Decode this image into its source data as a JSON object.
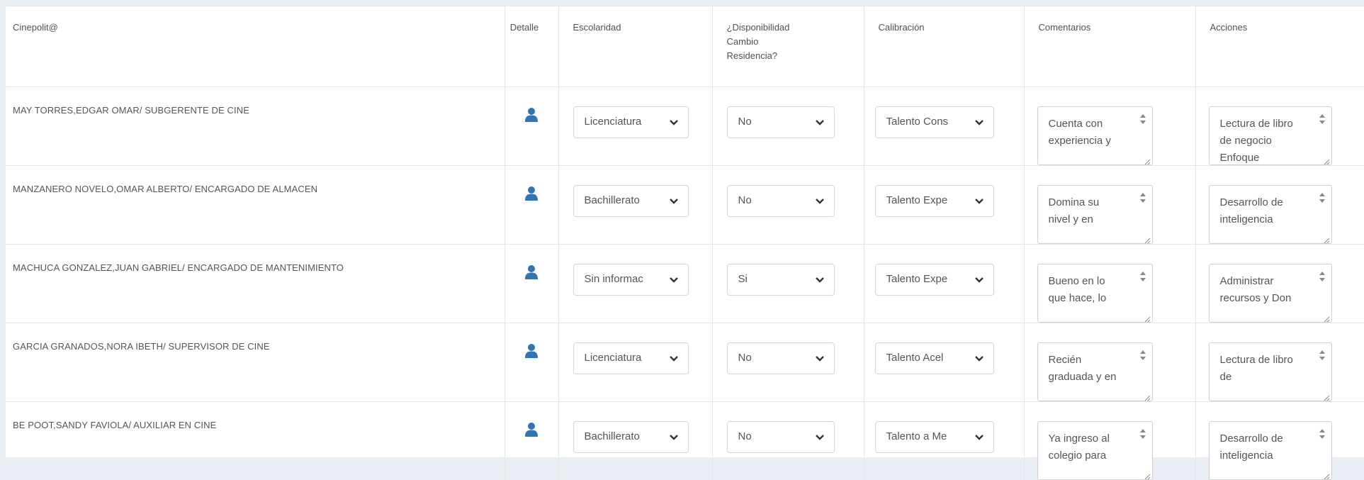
{
  "table": {
    "headers": {
      "cinepolita": "Cinepolit@",
      "detalle": "Detalle",
      "escolaridad": "Escolaridad",
      "disponibilidad_line1": "¿Disponibilidad",
      "disponibilidad_line2": "Cambio",
      "disponibilidad_line3": "Residencia?",
      "calibracion": "Calibración",
      "comentarios": "Comentarios",
      "acciones": "Acciones"
    },
    "rows": [
      {
        "name": "MAY TORRES,EDGAR OMAR/ SUBGERENTE DE CINE",
        "escolaridad": "Licenciatura",
        "disponibilidad": "No",
        "calibracion": "Talento Cons",
        "comentarios": "Cuenta con experiencia y",
        "acciones": "Lectura de libro de negocio Enfoque"
      },
      {
        "name": "MANZANERO NOVELO,OMAR ALBERTO/ ENCARGADO DE ALMACEN",
        "escolaridad": "Bachillerato",
        "disponibilidad": "No",
        "calibracion": "Talento Expe",
        "comentarios": "Domina su nivel y en",
        "acciones": "Desarrollo de inteligencia"
      },
      {
        "name": "MACHUCA GONZALEZ,JUAN GABRIEL/ ENCARGADO DE MANTENIMIENTO",
        "escolaridad": "Sin informac",
        "disponibilidad": "Si",
        "calibracion": "Talento Expe",
        "comentarios": "Bueno en lo que hace, lo",
        "acciones": "Administrar recursos y Don"
      },
      {
        "name": "GARCIA GRANADOS,NORA IBETH/ SUPERVISOR DE CINE",
        "escolaridad": "Licenciatura",
        "disponibilidad": "No",
        "calibracion": "Talento Acel",
        "comentarios": "Recién graduada y en",
        "acciones": "Lectura de libro de"
      },
      {
        "name": "BE POOT,SANDY FAVIOLA/ AUXILIAR EN CINE",
        "escolaridad": "Bachillerato",
        "disponibilidad": "No",
        "calibracion": "Talento a Me",
        "comentarios": "Ya ingreso al colegio para",
        "acciones": "Desarrollo de inteligencia"
      }
    ]
  },
  "icons": {
    "detail": "person-icon",
    "select_arrow": "chevron-down-icon",
    "spinner": "spinner-arrows-icon",
    "resize": "resize-grip-icon"
  },
  "colors": {
    "person_icon": "#2f74b5",
    "border": "#d5d5d5",
    "page_bg": "#e9eef5"
  }
}
